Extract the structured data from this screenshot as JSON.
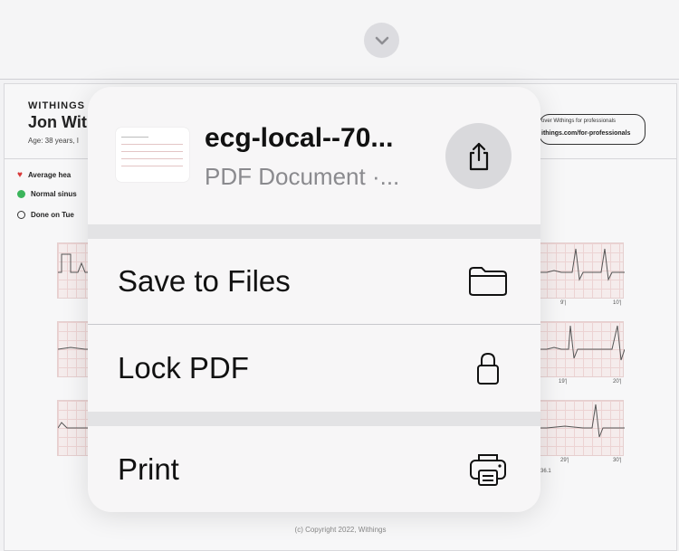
{
  "background_pdf": {
    "brand": "WITHINGS",
    "patient_name": "Jon Wit",
    "age_line": "Age: 38 years, I",
    "info_items": [
      {
        "icon": "heart-icon",
        "label": "Average hea"
      },
      {
        "icon": "green-dot-icon",
        "label": "Normal sinus"
      },
      {
        "icon": "clock-icon",
        "label": "Done on Tue"
      }
    ],
    "promo_top": "over Withings for professionals",
    "promo_url": "ithings.com/for-professionals",
    "tick_labels": {
      "strip1_left": "9'|",
      "strip1_right": "10'|",
      "strip2_left": "19'|",
      "strip2_right": "20'|",
      "strip3_left": "29'|",
      "strip3_right": "30'|",
      "below": "36.1"
    },
    "footer": "(c) Copyright 2022, Withings"
  },
  "sheet": {
    "document_name": "ecg-local--70...",
    "document_type": "PDF Document ·...",
    "actions": [
      {
        "label": "Save to Files",
        "icon": "folder-icon"
      },
      {
        "label": "Lock PDF",
        "icon": "lock-icon"
      },
      {
        "label": "Print",
        "icon": "printer-icon"
      }
    ]
  },
  "colors": {
    "sheet_bg": "#f7f6f7",
    "separator": "#e3e3e5",
    "share_button": "#d9d9dc",
    "secondary_text": "#8a8a8e"
  }
}
